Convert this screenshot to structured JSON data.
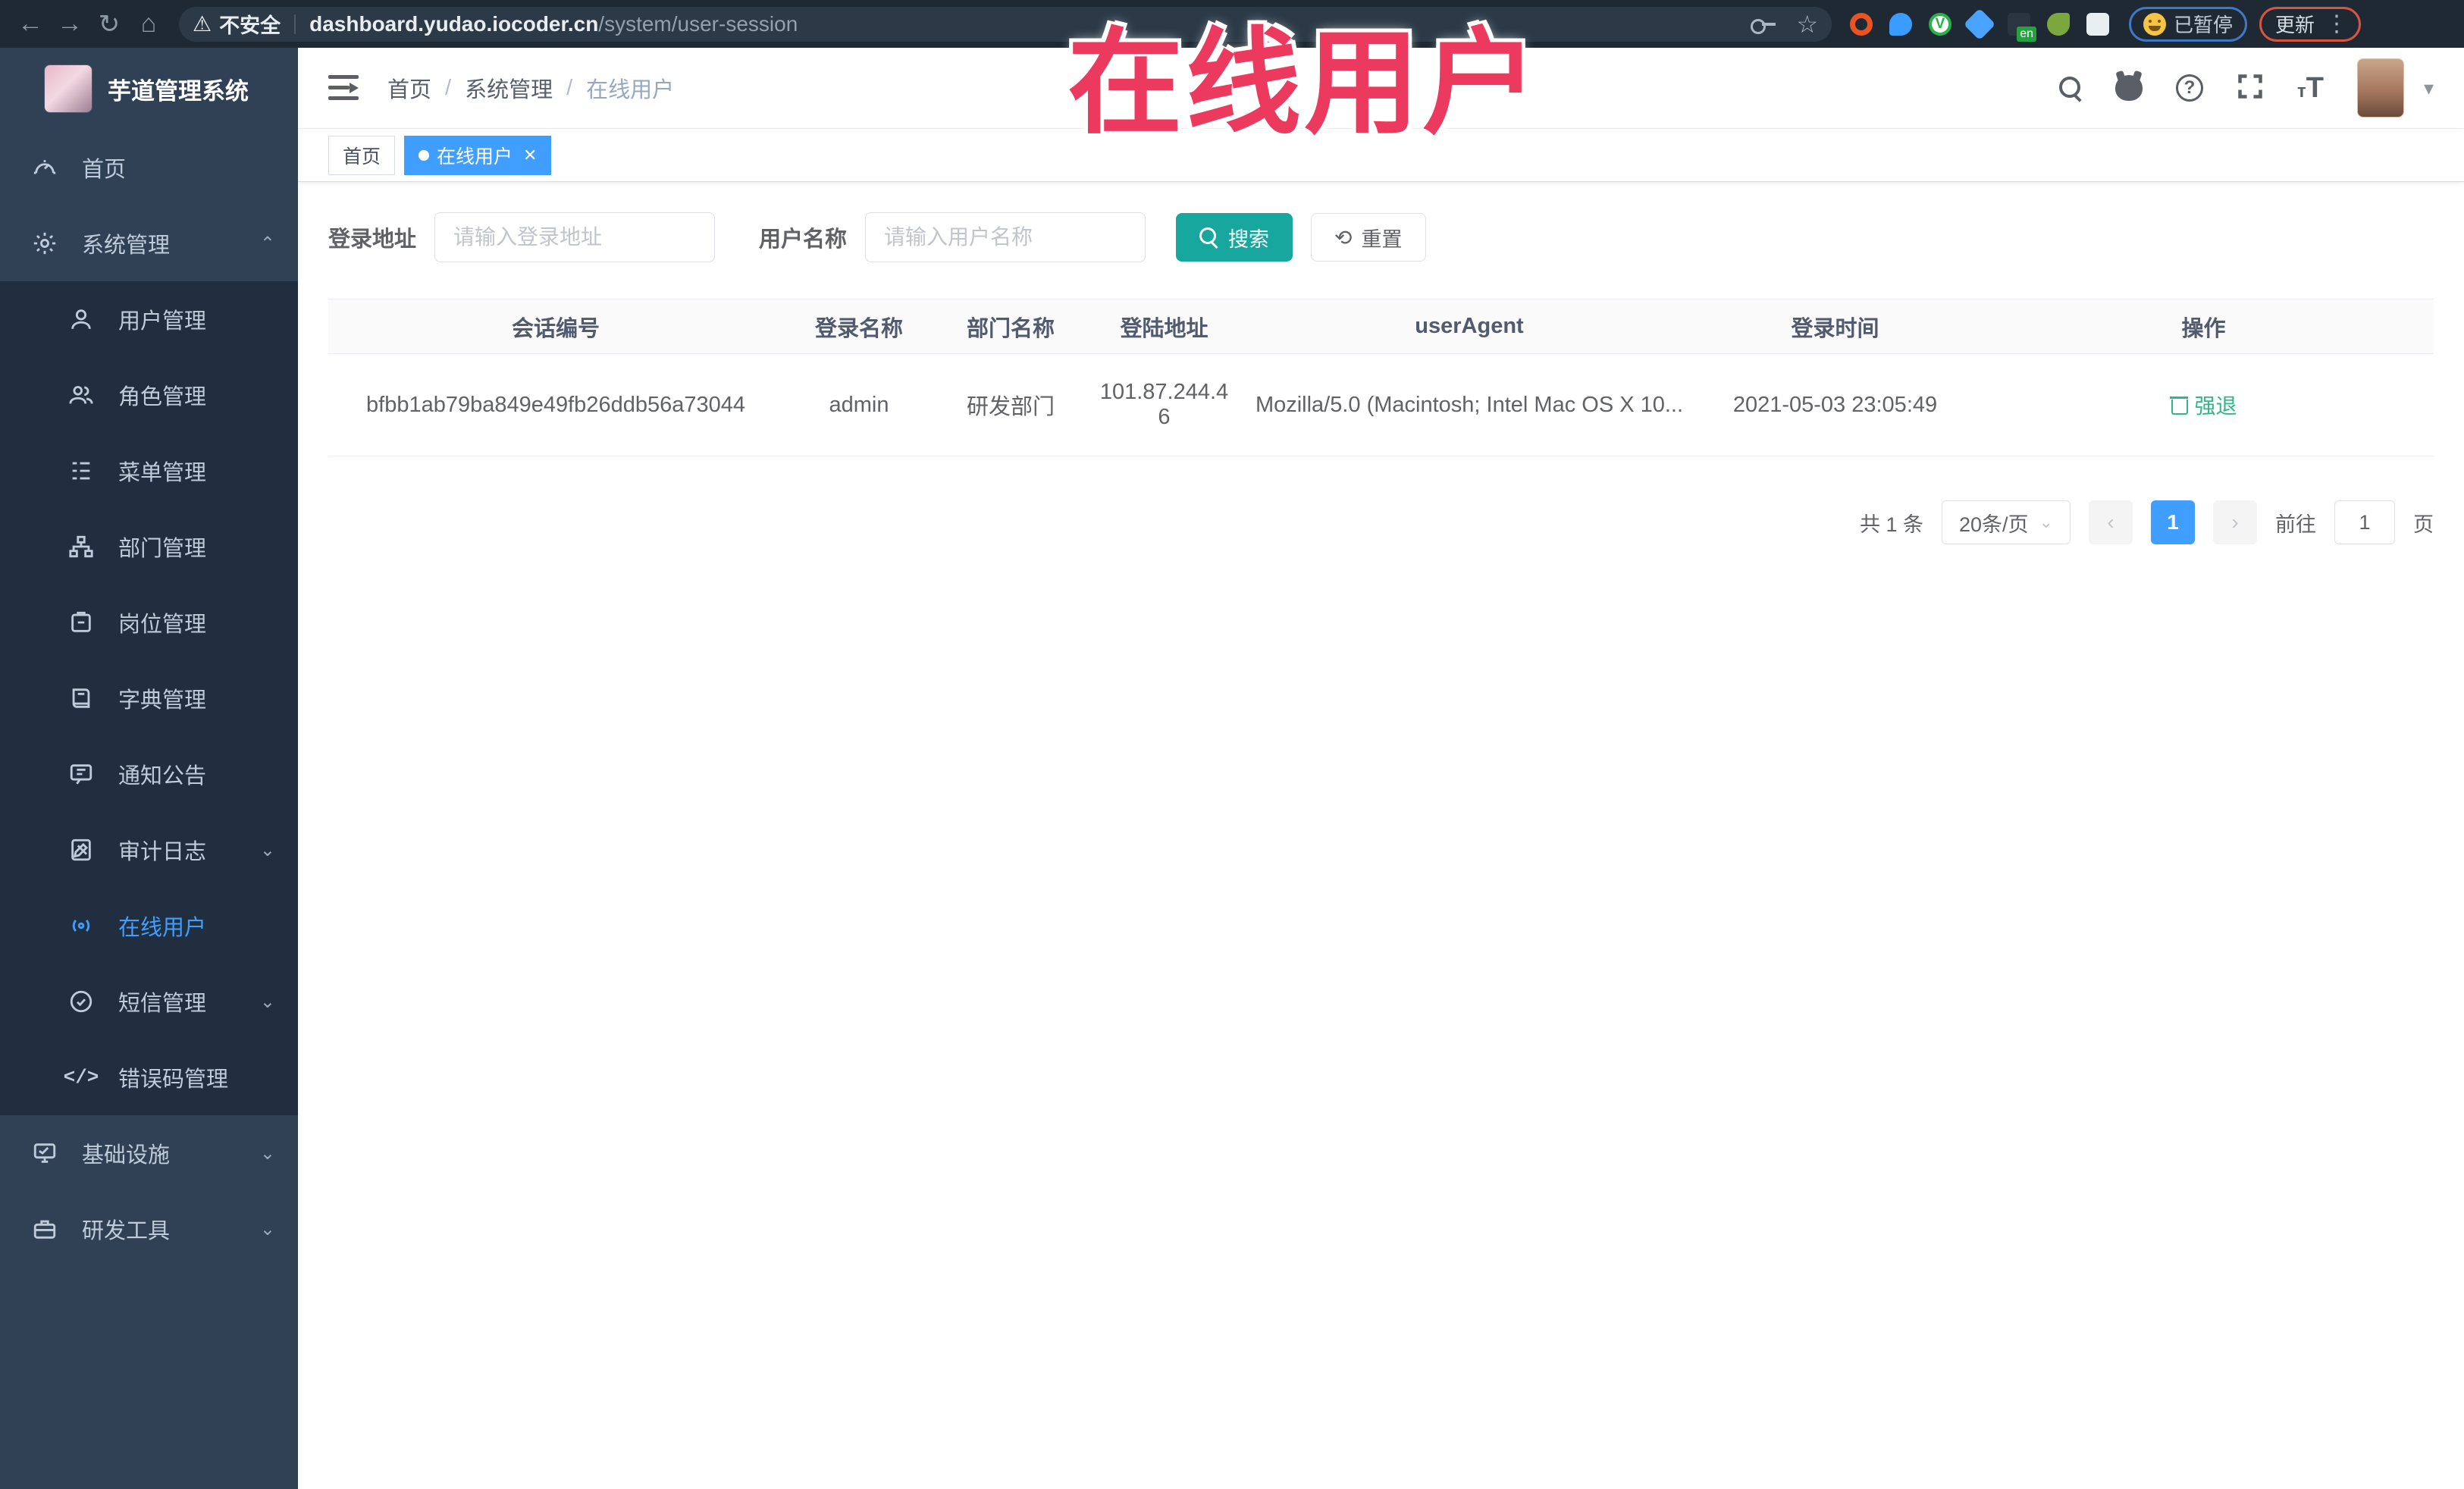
{
  "browser": {
    "security_label": "不安全",
    "url_host": "dashboard.yudao.iocoder.cn",
    "url_path": "/system/user-session",
    "paused_badge": "已暂停",
    "update_button": "更新"
  },
  "header": {
    "breadcrumb": [
      "首页",
      "系统管理",
      "在线用户"
    ]
  },
  "tags": [
    {
      "label": "首页",
      "active": false
    },
    {
      "label": "在线用户",
      "active": true
    }
  ],
  "sidebar": {
    "logo_title": "芋道管理系统",
    "home_label": "首页",
    "system_label": "系统管理",
    "children": [
      {
        "label": "用户管理",
        "icon": "user-icon"
      },
      {
        "label": "角色管理",
        "icon": "roles-icon"
      },
      {
        "label": "菜单管理",
        "icon": "menu-list-icon"
      },
      {
        "label": "部门管理",
        "icon": "org-tree-icon"
      },
      {
        "label": "岗位管理",
        "icon": "post-icon"
      },
      {
        "label": "字典管理",
        "icon": "dict-book-icon"
      },
      {
        "label": "通知公告",
        "icon": "notice-message-icon"
      },
      {
        "label": "审计日志",
        "icon": "audit-log-icon"
      },
      {
        "label": "在线用户",
        "icon": "online-users-icon"
      },
      {
        "label": "短信管理",
        "icon": "sms-shield-icon"
      },
      {
        "label": "错误码管理",
        "icon": "error-code-icon"
      }
    ],
    "bottom": [
      {
        "label": "基础设施",
        "icon": "infra-monitor-icon"
      },
      {
        "label": "研发工具",
        "icon": "devtools-icon"
      }
    ]
  },
  "filters": {
    "login_addr_label": "登录地址",
    "login_addr_placeholder": "请输入登录地址",
    "username_label": "用户名称",
    "username_placeholder": "请输入用户名称",
    "search_button": "搜索",
    "reset_button": "重置"
  },
  "table": {
    "headers": [
      "会话编号",
      "登录名称",
      "部门名称",
      "登陆地址",
      "userAgent",
      "登录时间",
      "操作"
    ],
    "row": {
      "session_id": "bfbb1ab79ba849e49fb26ddb56a73044",
      "login_name": "admin",
      "dept_name": "研发部门",
      "login_addr": "101.87.244.46",
      "user_agent": "Mozilla/5.0 (Macintosh; Intel Mac OS X 10...",
      "login_time": "2021-05-03 23:05:49",
      "action": "强退"
    }
  },
  "pagination": {
    "total_text": "共 1 条",
    "page_size": "20条/页",
    "prev": "‹",
    "current_page": "1",
    "next": "›",
    "goto_label": "前往",
    "goto_value": "1",
    "page_unit": "页"
  },
  "watermark": "在线用户",
  "colors": {
    "accent": "#409eff",
    "search_button": "#18a79e",
    "action_link": "#2eb888",
    "sidebar_bg": "#304156",
    "submenu_bg": "#202e40",
    "annotation": "#ec3a5e",
    "chrome_bg": "#1e2933"
  }
}
